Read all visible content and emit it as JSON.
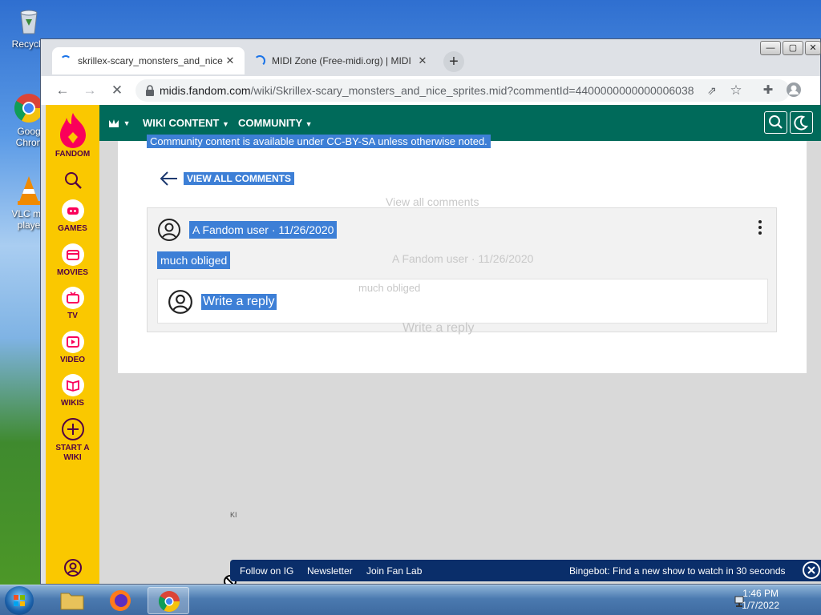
{
  "desktop": {
    "icons": [
      {
        "label": "Recycle",
        "icon": "recycle-bin-icon"
      },
      {
        "label": "Goog Chron",
        "icon": "chrome-icon"
      },
      {
        "label": "VLC me playe",
        "icon": "vlc-icon"
      }
    ]
  },
  "browser": {
    "tabs": [
      {
        "title": "skrillex-scary_monsters_and_nice",
        "close": "✕",
        "state": "loading"
      },
      {
        "title": "MIDI Zone (Free-midi.org) | MIDI",
        "close": "✕",
        "state": "loading"
      }
    ],
    "new_tab": "+",
    "url_host": "midis.fandom.com",
    "url_path": "/wiki/Skrillex-scary_monsters_and_nice_sprites.mid?commentId=4400000000000006038"
  },
  "fandom": {
    "rail": [
      {
        "label": "FANDOM",
        "icon": "fandom-flame-icon"
      },
      {
        "label": "",
        "icon": "search-icon"
      },
      {
        "label": "GAMES",
        "icon": "games-icon"
      },
      {
        "label": "MOVIES",
        "icon": "movies-icon"
      },
      {
        "label": "TV",
        "icon": "tv-icon"
      },
      {
        "label": "VIDEO",
        "icon": "video-icon"
      },
      {
        "label": "WIKIS",
        "icon": "wikis-icon"
      },
      {
        "label": "START A WIKI",
        "icon": "plus-circle-icon"
      }
    ],
    "nav": {
      "wiki_content": "WIKI CONTENT",
      "community": "COMMUNITY"
    },
    "license_line": "Community content is available under CC-BY-SA unless otherwise noted.",
    "back_link": "VIEW ALL COMMENTS",
    "ghost_view_all": "View all comments",
    "comment": {
      "author": "A Fandom user",
      "separator": "·",
      "date": "11/26/2020",
      "body": "much obliged",
      "reply_placeholder": "Write a reply"
    },
    "ghost": {
      "author_line": "A Fandom user · 11/26/2020",
      "body": "much obliged",
      "reply": "Write a reply"
    },
    "stray_text": "KI",
    "bottom_bar": {
      "follow": "Follow on IG",
      "newsletter": "Newsletter",
      "fan_lab": "Join Fan Lab",
      "bingebot": "Bingebot: Find a new show to watch in 30 seconds"
    }
  },
  "taskbar": {
    "time": "1:46 PM",
    "date": "1/7/2022"
  },
  "colors": {
    "fandom_yellow": "#fac800",
    "fandom_nav": "#006a5a",
    "selection": "#3d7fd6",
    "bottom_bar": "#0a2e6a"
  }
}
